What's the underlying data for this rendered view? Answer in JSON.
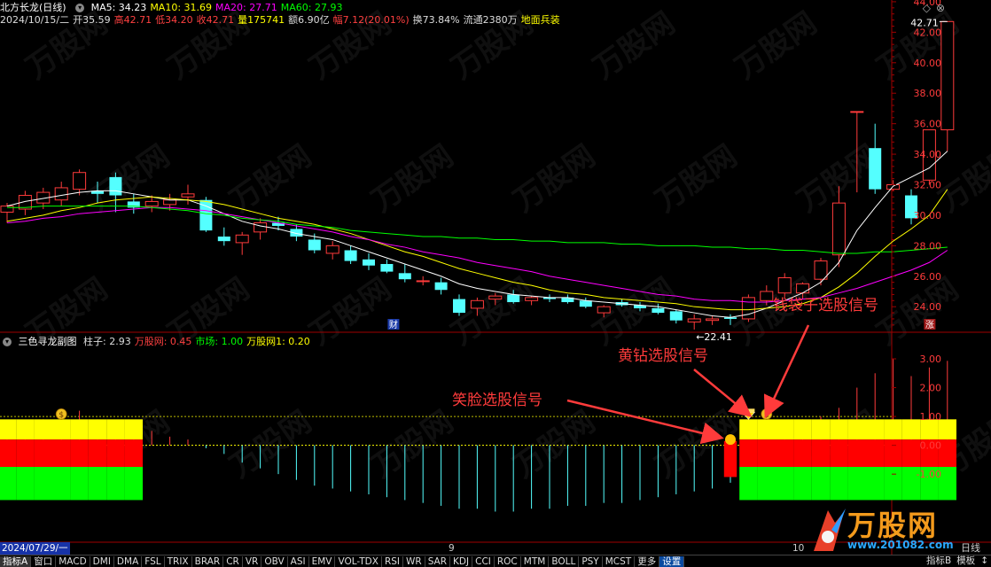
{
  "header": {
    "name": "北方长龙(日线)",
    "ma": [
      {
        "label": "MA5: 34.23",
        "color": "#ffffff"
      },
      {
        "label": "MA10: 31.69",
        "color": "#ffff00"
      },
      {
        "label": "MA20: 27.71",
        "color": "#ff00ff"
      },
      {
        "label": "MA60: 27.93",
        "color": "#00ff00"
      }
    ],
    "info": [
      {
        "label": "2024/10/15/二",
        "color": "#dddddd"
      },
      {
        "label": "开35.59",
        "color": "#dddddd"
      },
      {
        "label": "高42.71",
        "color": "#ff4040"
      },
      {
        "label": "低34.20",
        "color": "#ff4040"
      },
      {
        "label": "收42.71",
        "color": "#ff4040"
      },
      {
        "label": "量175741",
        "color": "#ffff00"
      },
      {
        "label": "额6.90亿",
        "color": "#dddddd"
      },
      {
        "label": "幅7.12(20.01%)",
        "color": "#ff4040"
      },
      {
        "label": "换73.84%",
        "color": "#dddddd"
      },
      {
        "label": "流通2380万",
        "color": "#dddddd"
      },
      {
        "label": "地面兵装",
        "color": "#ffff00"
      }
    ]
  },
  "sub_header": {
    "name": "三色寻龙副图",
    "items": [
      {
        "label": "柱子: 2.93",
        "color": "#dddddd"
      },
      {
        "label": "万股网: 0.45",
        "color": "#ff4040"
      },
      {
        "label": "市场: 1.00",
        "color": "#00ff00"
      },
      {
        "label": "万股网1: 0.20",
        "color": "#ffff00"
      }
    ]
  },
  "chart_data": [
    {
      "type": "candlestick",
      "title": "北方长龙(日线)",
      "ylim": [
        22.5,
        43.3
      ],
      "y_ticks": [
        "44.00",
        "42.00",
        "40.00",
        "38.00",
        "36.00",
        "34.00",
        "32.00",
        "30.00",
        "28.00",
        "26.00",
        "24.00"
      ],
      "annotations": {
        "high_label": "42.71",
        "low_label": "←22.41",
        "marker_cai": "财",
        "marker_zhang": "涨"
      },
      "candles": [
        {
          "o": 30.2,
          "h": 30.8,
          "l": 29.5,
          "c": 30.6
        },
        {
          "o": 30.4,
          "h": 31.6,
          "l": 30.0,
          "c": 31.3
        },
        {
          "o": 30.8,
          "h": 31.8,
          "l": 30.4,
          "c": 31.5
        },
        {
          "o": 31.0,
          "h": 32.2,
          "l": 30.6,
          "c": 31.8
        },
        {
          "o": 31.7,
          "h": 33.0,
          "l": 31.3,
          "c": 32.8
        },
        {
          "o": 31.6,
          "h": 32.2,
          "l": 30.8,
          "c": 31.4
        },
        {
          "o": 32.5,
          "h": 32.8,
          "l": 30.2,
          "c": 31.3
        },
        {
          "o": 30.9,
          "h": 31.4,
          "l": 30.1,
          "c": 30.5
        },
        {
          "o": 30.6,
          "h": 31.3,
          "l": 30.2,
          "c": 30.9
        },
        {
          "o": 30.7,
          "h": 31.4,
          "l": 30.3,
          "c": 31.0
        },
        {
          "o": 31.2,
          "h": 32.0,
          "l": 30.7,
          "c": 31.4
        },
        {
          "o": 31.0,
          "h": 31.2,
          "l": 28.9,
          "c": 29.0
        },
        {
          "o": 28.6,
          "h": 29.2,
          "l": 28.0,
          "c": 28.3
        },
        {
          "o": 28.2,
          "h": 28.9,
          "l": 27.4,
          "c": 28.7
        },
        {
          "o": 28.9,
          "h": 29.8,
          "l": 28.4,
          "c": 29.5
        },
        {
          "o": 29.5,
          "h": 29.9,
          "l": 29.0,
          "c": 29.3
        },
        {
          "o": 29.1,
          "h": 29.4,
          "l": 28.3,
          "c": 28.6
        },
        {
          "o": 28.4,
          "h": 28.8,
          "l": 27.5,
          "c": 27.7
        },
        {
          "o": 27.5,
          "h": 28.3,
          "l": 27.1,
          "c": 28.0
        },
        {
          "o": 27.7,
          "h": 28.0,
          "l": 26.8,
          "c": 27.0
        },
        {
          "o": 27.1,
          "h": 27.5,
          "l": 26.4,
          "c": 26.7
        },
        {
          "o": 26.8,
          "h": 27.1,
          "l": 26.2,
          "c": 26.3
        },
        {
          "o": 26.2,
          "h": 26.8,
          "l": 25.6,
          "c": 25.8
        },
        {
          "o": 25.7,
          "h": 26.0,
          "l": 25.4,
          "c": 25.7
        },
        {
          "o": 25.6,
          "h": 25.9,
          "l": 24.8,
          "c": 25.1
        },
        {
          "o": 24.5,
          "h": 24.8,
          "l": 23.4,
          "c": 23.6
        },
        {
          "o": 23.9,
          "h": 24.6,
          "l": 23.4,
          "c": 24.4
        },
        {
          "o": 24.5,
          "h": 24.9,
          "l": 24.1,
          "c": 24.7
        },
        {
          "o": 24.8,
          "h": 25.1,
          "l": 24.2,
          "c": 24.3
        },
        {
          "o": 24.4,
          "h": 24.7,
          "l": 24.1,
          "c": 24.6
        },
        {
          "o": 24.6,
          "h": 24.8,
          "l": 24.3,
          "c": 24.5
        },
        {
          "o": 24.6,
          "h": 24.8,
          "l": 24.2,
          "c": 24.3
        },
        {
          "o": 24.4,
          "h": 24.6,
          "l": 23.9,
          "c": 24.0
        },
        {
          "o": 23.6,
          "h": 24.1,
          "l": 23.3,
          "c": 24.0
        },
        {
          "o": 24.3,
          "h": 24.5,
          "l": 24.0,
          "c": 24.1
        },
        {
          "o": 24.1,
          "h": 24.3,
          "l": 23.7,
          "c": 23.9
        },
        {
          "o": 23.9,
          "h": 24.2,
          "l": 23.5,
          "c": 23.6
        },
        {
          "o": 23.7,
          "h": 23.8,
          "l": 22.9,
          "c": 23.1
        },
        {
          "o": 23.0,
          "h": 23.5,
          "l": 22.5,
          "c": 23.2
        },
        {
          "o": 23.1,
          "h": 23.4,
          "l": 22.8,
          "c": 23.2
        },
        {
          "o": 23.3,
          "h": 23.5,
          "l": 22.8,
          "c": 23.2
        },
        {
          "o": 23.2,
          "h": 24.8,
          "l": 23.0,
          "c": 24.6
        },
        {
          "o": 24.4,
          "h": 25.4,
          "l": 24.1,
          "c": 25.0
        },
        {
          "o": 24.9,
          "h": 26.2,
          "l": 24.6,
          "c": 25.9
        },
        {
          "o": 24.9,
          "h": 25.6,
          "l": 24.5,
          "c": 25.5
        },
        {
          "o": 25.8,
          "h": 27.2,
          "l": 25.4,
          "c": 27.0
        },
        {
          "o": 27.4,
          "h": 31.9,
          "l": 26.6,
          "c": 30.8
        },
        {
          "o": 36.8,
          "h": 36.8,
          "l": 31.5,
          "c": 36.8
        },
        {
          "o": 34.4,
          "h": 36.0,
          "l": 31.4,
          "c": 31.7
        },
        {
          "o": 31.7,
          "h": 32.3,
          "l": 31.6,
          "c": 32.0
        },
        {
          "o": 31.3,
          "h": 31.7,
          "l": 29.4,
          "c": 29.8
        },
        {
          "o": 32.3,
          "h": 34.1,
          "l": 32.0,
          "c": 35.6
        },
        {
          "o": 35.6,
          "h": 42.7,
          "l": 34.2,
          "c": 42.7
        }
      ],
      "ma_series": [
        {
          "name": "MA5",
          "color": "#ffffff",
          "values": [
            30.6,
            30.9,
            31.1,
            31.3,
            31.5,
            31.6,
            31.6,
            31.4,
            31.2,
            31.0,
            31.0,
            30.6,
            30.1,
            29.6,
            29.3,
            29.1,
            28.8,
            28.6,
            28.4,
            28.0,
            27.6,
            27.2,
            26.8,
            26.4,
            26.0,
            25.5,
            25.2,
            25.0,
            24.8,
            24.7,
            24.6,
            24.6,
            24.4,
            24.3,
            24.2,
            24.1,
            24.0,
            23.8,
            23.6,
            23.4,
            23.3,
            23.5,
            23.9,
            24.4,
            24.9,
            25.6,
            26.9,
            29.0,
            30.5,
            31.9,
            32.5,
            33.1,
            34.2
          ]
        },
        {
          "name": "MA10",
          "color": "#ffff00",
          "values": [
            29.6,
            29.8,
            30.0,
            30.3,
            30.5,
            30.8,
            31.0,
            31.1,
            31.2,
            31.1,
            31.0,
            30.9,
            30.7,
            30.4,
            30.1,
            29.8,
            29.6,
            29.4,
            29.1,
            28.8,
            28.4,
            28.0,
            27.6,
            27.3,
            26.9,
            26.5,
            26.2,
            25.9,
            25.6,
            25.4,
            25.1,
            24.9,
            24.8,
            24.6,
            24.5,
            24.4,
            24.3,
            24.2,
            24.0,
            23.9,
            23.8,
            23.8,
            23.9,
            24.0,
            24.2,
            24.6,
            25.3,
            26.2,
            27.3,
            28.3,
            29.1,
            30.0,
            31.7
          ]
        },
        {
          "name": "MA20",
          "color": "#ff00ff",
          "values": [
            29.5,
            29.6,
            29.8,
            29.9,
            30.1,
            30.2,
            30.3,
            30.4,
            30.5,
            30.5,
            30.4,
            30.3,
            30.1,
            29.9,
            29.7,
            29.5,
            29.3,
            29.1,
            28.9,
            28.6,
            28.4,
            28.1,
            27.9,
            27.6,
            27.4,
            27.2,
            26.9,
            26.7,
            26.5,
            26.3,
            26.0,
            25.8,
            25.6,
            25.4,
            25.2,
            25.0,
            24.8,
            24.7,
            24.5,
            24.4,
            24.4,
            24.3,
            24.3,
            24.4,
            24.5,
            24.6,
            24.9,
            25.2,
            25.6,
            26.0,
            26.4,
            26.9,
            27.7
          ]
        },
        {
          "name": "MA60",
          "color": "#00ff00",
          "values": [
            30.5,
            30.5,
            30.6,
            30.6,
            30.6,
            30.6,
            30.6,
            30.6,
            30.5,
            30.4,
            30.3,
            30.1,
            30.0,
            29.8,
            29.7,
            29.6,
            29.4,
            29.3,
            29.2,
            29.0,
            28.9,
            28.8,
            28.7,
            28.6,
            28.6,
            28.5,
            28.5,
            28.4,
            28.4,
            28.3,
            28.3,
            28.2,
            28.2,
            28.2,
            28.1,
            28.1,
            28.0,
            28.0,
            28.0,
            27.9,
            27.9,
            27.8,
            27.8,
            27.7,
            27.7,
            27.6,
            27.5,
            27.5,
            27.6,
            27.6,
            27.7,
            27.8,
            27.9
          ]
        }
      ]
    },
    {
      "type": "bar",
      "title": "三色寻龙副图",
      "ylim": [
        -3.3,
        3.4
      ],
      "y_ticks": [
        "3.00",
        "2.00",
        "1.00",
        "0.00",
        "-1.00"
      ],
      "reference_lines": [
        1.0,
        0.0
      ],
      "pillar_values": [
        0.5,
        0.8,
        0.9,
        1.1,
        1.2,
        0.9,
        0.7,
        0.6,
        0.5,
        0.3,
        0.2,
        -0.1,
        -0.3,
        -0.6,
        -0.8,
        -1.0,
        -1.2,
        -1.4,
        -1.5,
        -1.6,
        -1.7,
        -1.8,
        -1.9,
        -2.0,
        -2.1,
        -2.2,
        -2.2,
        -2.3,
        -2.3,
        -2.2,
        -2.2,
        -2.1,
        -2.1,
        -2.0,
        -2.0,
        -1.9,
        -1.8,
        -1.7,
        -1.6,
        -1.5,
        -1.3,
        -0.8,
        -0.5,
        0.2,
        0.9,
        1.0,
        1.3,
        2.0,
        2.5,
        3.0,
        2.4,
        2.7,
        2.93
      ],
      "three_color_segments": [
        {
          "from": 0,
          "to": 8,
          "colors": [
            "#ff0000",
            "#00ff00",
            "#ffff00"
          ],
          "tag": "money-bag"
        },
        {
          "from": 40,
          "to": 41,
          "colors": [
            "#ff0000"
          ],
          "tag": "smiley"
        },
        {
          "from": 41,
          "to": 53,
          "colors": [
            "#ff0000",
            "#00ff00",
            "#ffff00"
          ],
          "tag": "money-bag"
        }
      ],
      "signal_icons": [
        {
          "name": "diamond-signal",
          "index": 41
        },
        {
          "name": "money-bag-signal",
          "index": 42
        },
        {
          "name": "smiley-signal",
          "index": 40
        },
        {
          "name": "money-bag-signal",
          "index": 3
        }
      ],
      "annotations": [
        {
          "text": "笑脸选股信号",
          "color": "#ff3b3b",
          "target": 40
        },
        {
          "text": "黄钻选股信号",
          "color": "#ff3b3b",
          "target": 41
        },
        {
          "text": "钱袋子选股信号",
          "color": "#ff3b3b",
          "target": 42
        }
      ]
    }
  ],
  "date_row": [
    {
      "label": "2024/07/29/一",
      "selected": true
    },
    {
      "label": "9",
      "selected": false
    },
    {
      "label": "10",
      "selected": false
    }
  ],
  "date_right": "日线",
  "tabs": [
    "指标A",
    "窗口",
    "MACD",
    "DMI",
    "DMA",
    "FSL",
    "TRIX",
    "BRAR",
    "CR",
    "VR",
    "OBV",
    "ASI",
    "EMV",
    "VOL-TDX",
    "RSI",
    "WR",
    "SAR",
    "KDJ",
    "CCI",
    "ROC",
    "MTM",
    "BOLL",
    "PSY",
    "MCST",
    "更多",
    "设置"
  ],
  "tabs_right": [
    "指标B",
    "模板",
    "↕"
  ],
  "logo": {
    "text": "万股网",
    "url": "www.201082.com"
  },
  "watermark": "万股网",
  "colors": {
    "up": "#ff3b3b",
    "down": "#54ffff",
    "axis": "#a00000",
    "grid": "#330000"
  }
}
